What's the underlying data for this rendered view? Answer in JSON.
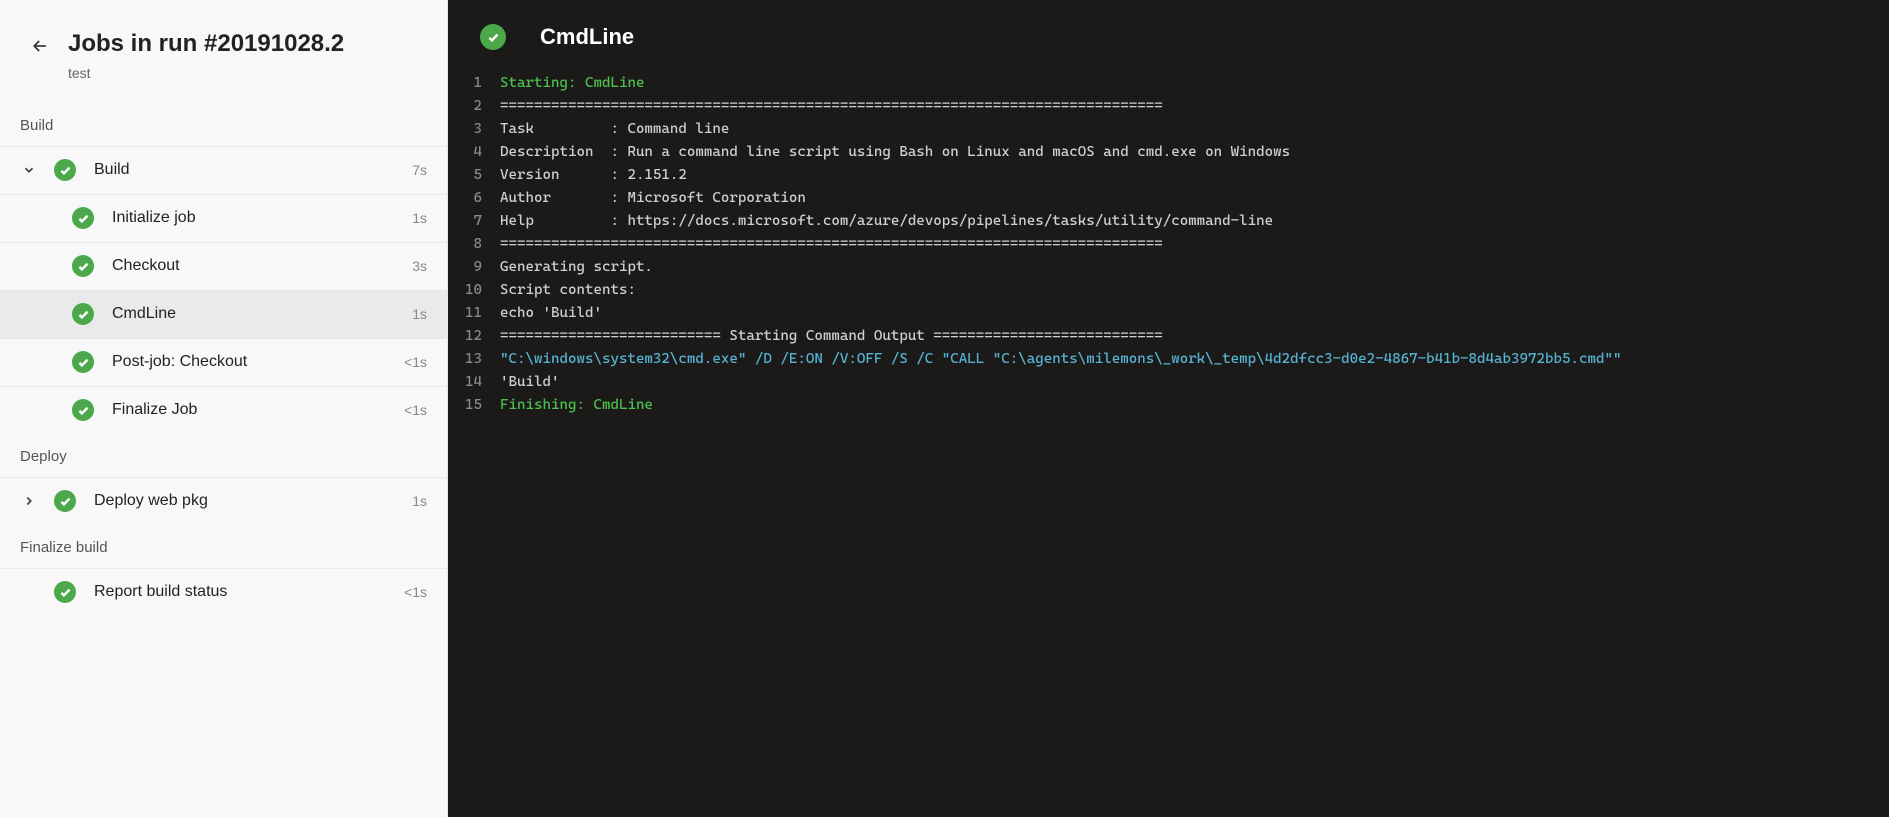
{
  "header": {
    "title": "Jobs in run #20191028.2",
    "subtitle": "test"
  },
  "main": {
    "title": "CmdLine"
  },
  "stages": [
    {
      "name": "Build",
      "jobs": [
        {
          "name": "Build",
          "duration": "7s",
          "expanded": true,
          "steps": [
            {
              "name": "Initialize job",
              "duration": "1s",
              "selected": false
            },
            {
              "name": "Checkout",
              "duration": "3s",
              "selected": false
            },
            {
              "name": "CmdLine",
              "duration": "1s",
              "selected": true
            },
            {
              "name": "Post-job: Checkout",
              "duration": "<1s",
              "selected": false
            },
            {
              "name": "Finalize Job",
              "duration": "<1s",
              "selected": false
            }
          ]
        }
      ]
    },
    {
      "name": "Deploy",
      "jobs": [
        {
          "name": "Deploy web pkg",
          "duration": "1s",
          "expanded": false,
          "steps": []
        }
      ]
    },
    {
      "name": "Finalize build",
      "jobs": [
        {
          "name": "Report build status",
          "duration": "<1s",
          "no_chevron": true,
          "steps": []
        }
      ]
    }
  ],
  "log": [
    {
      "n": 1,
      "cls": "c-green",
      "text": "Starting: CmdLine"
    },
    {
      "n": 2,
      "cls": "c-white",
      "text": "=============================================================================="
    },
    {
      "n": 3,
      "cls": "c-white",
      "text": "Task         : Command line"
    },
    {
      "n": 4,
      "cls": "c-white",
      "text": "Description  : Run a command line script using Bash on Linux and macOS and cmd.exe on Windows"
    },
    {
      "n": 5,
      "cls": "c-white",
      "text": "Version      : 2.151.2"
    },
    {
      "n": 6,
      "cls": "c-white",
      "text": "Author       : Microsoft Corporation"
    },
    {
      "n": 7,
      "cls": "c-white",
      "text": "Help         : https://docs.microsoft.com/azure/devops/pipelines/tasks/utility/command-line"
    },
    {
      "n": 8,
      "cls": "c-white",
      "text": "=============================================================================="
    },
    {
      "n": 9,
      "cls": "c-white",
      "text": "Generating script."
    },
    {
      "n": 10,
      "cls": "c-white",
      "text": "Script contents:"
    },
    {
      "n": 11,
      "cls": "c-white",
      "text": "echo 'Build'"
    },
    {
      "n": 12,
      "cls": "c-white",
      "text": "========================== Starting Command Output ==========================="
    },
    {
      "n": 13,
      "cls": "c-cyan",
      "text": "\"C:\\windows\\system32\\cmd.exe\" /D /E:ON /V:OFF /S /C \"CALL \"C:\\agents\\milemons\\_work\\_temp\\4d2dfcc3-d0e2-4867-b41b-8d4ab3972bb5.cmd\"\""
    },
    {
      "n": 14,
      "cls": "c-white",
      "text": "'Build'"
    },
    {
      "n": 15,
      "cls": "c-green",
      "text": "Finishing: CmdLine"
    }
  ]
}
